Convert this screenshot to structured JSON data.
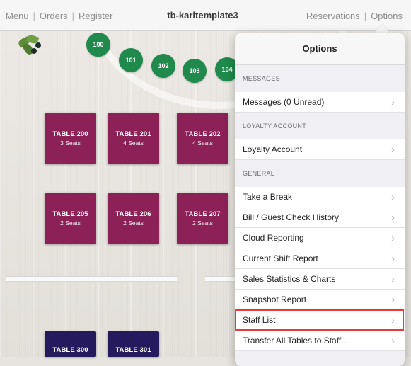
{
  "nav": {
    "menu": "Menu",
    "orders": "Orders",
    "register": "Register",
    "title": "tb-karltemplate3",
    "reservations": "Reservations",
    "options": "Options",
    "separator": "|"
  },
  "floor": {
    "seats": [
      "100",
      "101",
      "102",
      "103",
      "104"
    ],
    "tables": [
      {
        "name": "TABLE 200",
        "seats": "3 Seats"
      },
      {
        "name": "TABLE 201",
        "seats": "4 Seats"
      },
      {
        "name": "TABLE 202",
        "seats": "4 Seats"
      },
      {
        "name": "TABLE 205",
        "seats": "2 Seats"
      },
      {
        "name": "TABLE 206",
        "seats": "2 Seats"
      },
      {
        "name": "TABLE 207",
        "seats": "2 Seats"
      },
      {
        "name": "TABLE 300",
        "seats": ""
      },
      {
        "name": "TABLE 301",
        "seats": ""
      }
    ],
    "colors": {
      "table": "#8b2157",
      "table_alt": "#251a5e",
      "seat": "#1f8a4c"
    }
  },
  "options": {
    "title": "Options",
    "chevron": "›",
    "sections": [
      {
        "header": "MESSAGES",
        "items": [
          "Messages (0 Unread)"
        ]
      },
      {
        "header": "LOYALTY ACCOUNT",
        "items": [
          "Loyalty Account"
        ]
      },
      {
        "header": "GENERAL",
        "items": [
          "Take a Break",
          "Bill / Guest Check History",
          "Cloud Reporting",
          "Current Shift Report",
          "Sales Statistics & Charts",
          "Snapshot Report",
          "Staff List",
          "Transfer All Tables to Staff..."
        ]
      }
    ],
    "highlight_color": "#e53b3b"
  }
}
